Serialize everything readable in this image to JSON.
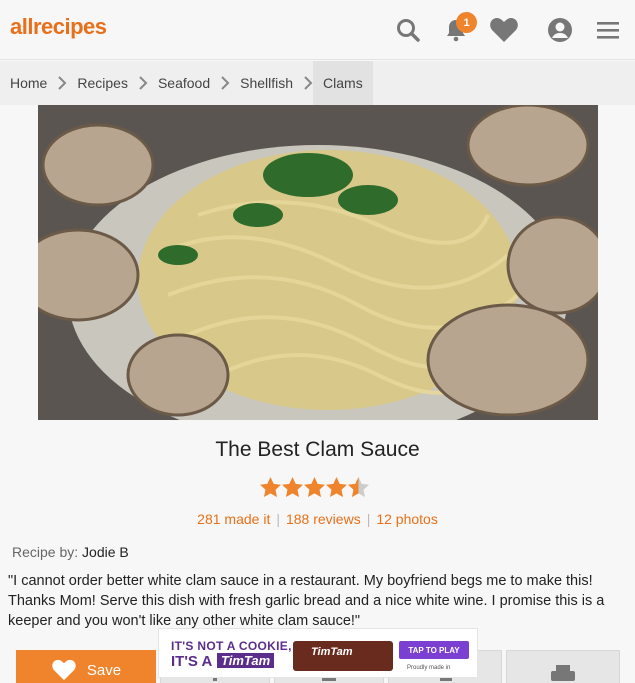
{
  "header": {
    "logo": "allrecipes",
    "notifications_count": "1"
  },
  "breadcrumb": [
    "Home",
    "Recipes",
    "Seafood",
    "Shellfish",
    "Clams"
  ],
  "recipe": {
    "title": "The Best Clam Sauce",
    "rating": 4.5,
    "made_it": "281 made it",
    "reviews": "188 reviews",
    "photos": "12 photos",
    "byline_label": "Recipe by:",
    "author": "Jodie B",
    "description": "\"I cannot order better white clam sauce in a restaurant. My boyfriend begs me to make this! Thanks Mom! Serve this dish with fresh garlic bread and a nice white wine. I promise this is a keeper and you won't like any other white clam sauce!\""
  },
  "actions": {
    "save_label": "Save"
  },
  "ad": {
    "line1": "IT'S NOT A COOKIE,",
    "line2": "IT'S A",
    "brand": "TimTam",
    "cta": "TAP TO PLAY",
    "fineprint": "Proudly made in"
  },
  "colors": {
    "accent": "#e8701a",
    "save_button": "#f0842c",
    "star": "#f0842c"
  }
}
